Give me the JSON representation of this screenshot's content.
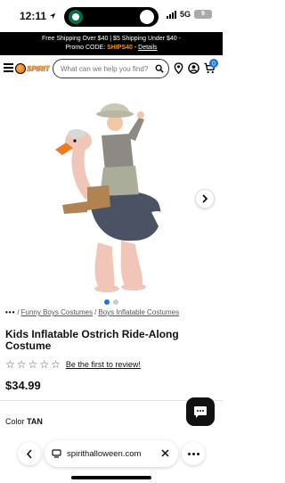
{
  "status_bar": {
    "time": "12:11",
    "network": "5G",
    "battery": "9"
  },
  "promo": {
    "line1": "Free Shipping Over $40 | $5 Shipping Under $40 -",
    "line2_prefix": "Promo CODE: ",
    "code": "SHIPS40",
    "separator": " - ",
    "details_link": "Details"
  },
  "header": {
    "logo_text": "SPIRIT",
    "search_placeholder": "What can we help you find?",
    "cart_count": "0"
  },
  "product": {
    "breadcrumb": {
      "more": "•••",
      "items": [
        "Funny Boys Costumes",
        "Boys Inflatable Costumes"
      ],
      "separator": "/"
    },
    "title": "Kids Inflatable Ostrich Ride-Along Costume",
    "review_link": "Be the first to review!",
    "rating_stars": 0,
    "price": "$34.99",
    "color_label": "Color",
    "color_value": "TAN",
    "image_count": 2,
    "active_image": 1
  },
  "browser": {
    "url": "spirithalloween.com"
  },
  "colors": {
    "promo_code": "#f7941d",
    "active_dot": "#1a73e8",
    "ostrich_body": "#f2c5b9",
    "ostrich_beak": "#f07a20"
  }
}
